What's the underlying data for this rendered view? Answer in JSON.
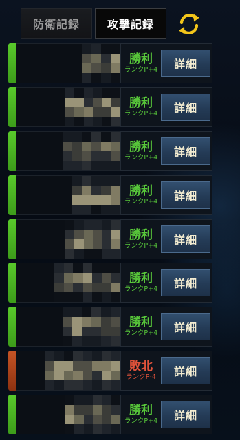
{
  "tabs": [
    {
      "label": "防衛記録",
      "active": false
    },
    {
      "label": "攻撃記録",
      "active": true
    }
  ],
  "refresh_icon": "refresh-arrows-icon",
  "colors": {
    "win": "#58c73a",
    "loss": "#e0523a",
    "refresh_accent": "#f3c51a"
  },
  "records": [
    {
      "result": "勝利",
      "rank": "ランクP+4",
      "outcome": "win",
      "detail_label": "詳細"
    },
    {
      "result": "勝利",
      "rank": "ランクP+4",
      "outcome": "win",
      "detail_label": "詳細"
    },
    {
      "result": "勝利",
      "rank": "ランクP+4",
      "outcome": "win",
      "detail_label": "詳細"
    },
    {
      "result": "勝利",
      "rank": "ランクP+4",
      "outcome": "win",
      "detail_label": "詳細"
    },
    {
      "result": "勝利",
      "rank": "ランクP+4",
      "outcome": "win",
      "detail_label": "詳細"
    },
    {
      "result": "勝利",
      "rank": "ランクP+4",
      "outcome": "win",
      "detail_label": "詳細"
    },
    {
      "result": "勝利",
      "rank": "ランクP+4",
      "outcome": "win",
      "detail_label": "詳細"
    },
    {
      "result": "敗北",
      "rank": "ランクP-4",
      "outcome": "loss",
      "detail_label": "詳細"
    },
    {
      "result": "勝利",
      "rank": "ランクP+4",
      "outcome": "win",
      "detail_label": "詳細"
    }
  ]
}
